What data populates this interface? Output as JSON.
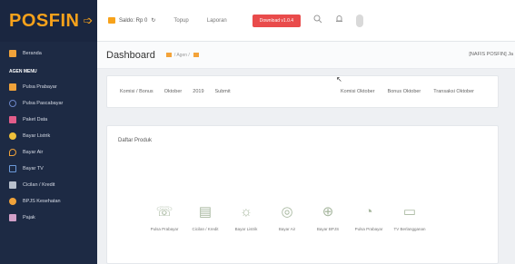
{
  "brand": {
    "name": "POSFIN",
    "arrow": "➩"
  },
  "sidebar": {
    "items_top": [
      {
        "label": "Beranda",
        "icon": "home-icon"
      }
    ],
    "section_label": "AGEN MENU",
    "items": [
      {
        "label": "Pulsa Prabayar",
        "icon": "phone-icon"
      },
      {
        "label": "Pulsa Pascabayar",
        "icon": "clock-icon"
      },
      {
        "label": "Paket Data",
        "icon": "package-icon"
      },
      {
        "label": "Bayar Listrik",
        "icon": "bolt-icon"
      },
      {
        "label": "Bayar Air",
        "icon": "drop-icon"
      },
      {
        "label": "Bayar TV",
        "icon": "tv-icon"
      },
      {
        "label": "Cicilan / Kredit",
        "icon": "card-icon"
      },
      {
        "label": "BPJS Kesehatan",
        "icon": "health-icon"
      },
      {
        "label": "Pajak",
        "icon": "tax-icon"
      }
    ]
  },
  "topbar": {
    "saldo": "Saldo: Rp 0",
    "refresh": "↻",
    "menus": [
      "Topup",
      "Laporan"
    ],
    "action_button": "Download v1.0.4",
    "icons": [
      "search-icon",
      "bell-icon",
      "user-icon"
    ]
  },
  "header": {
    "title": "Dashboard",
    "breadcrumb": "/ Agen /",
    "user": "[NAFIS POSFIN] Ja"
  },
  "promo": {
    "left": [
      "Komisi / Bonus",
      "Oktober",
      "2019",
      "Submit"
    ],
    "right": [
      "Komisi Oktober",
      "Bonus Oktober",
      "Transaksi Oktober"
    ]
  },
  "produk": {
    "title": "Daftar Produk",
    "items": [
      {
        "label": "Pulsa Prabayar",
        "glyph": "☏",
        "icon": "phone-icon"
      },
      {
        "label": "Cicilan / Kredit",
        "glyph": "▤",
        "icon": "list-icon"
      },
      {
        "label": "Bayar Listrik",
        "glyph": "☼",
        "icon": "bulb-icon"
      },
      {
        "label": "Bayar Air",
        "glyph": "◎",
        "icon": "water-icon"
      },
      {
        "label": "Bayar BPJS",
        "glyph": "⊕",
        "icon": "health-icon"
      },
      {
        "label": "Pulsa Prabayar",
        "glyph": "◔",
        "icon": "clock-icon"
      },
      {
        "label": "TV Berlangganan",
        "glyph": "▭",
        "icon": "tv-icon"
      }
    ]
  },
  "colors": {
    "sidebar": "#1d2a44",
    "brand": "#f7a21b",
    "action": "#e94b4b"
  }
}
